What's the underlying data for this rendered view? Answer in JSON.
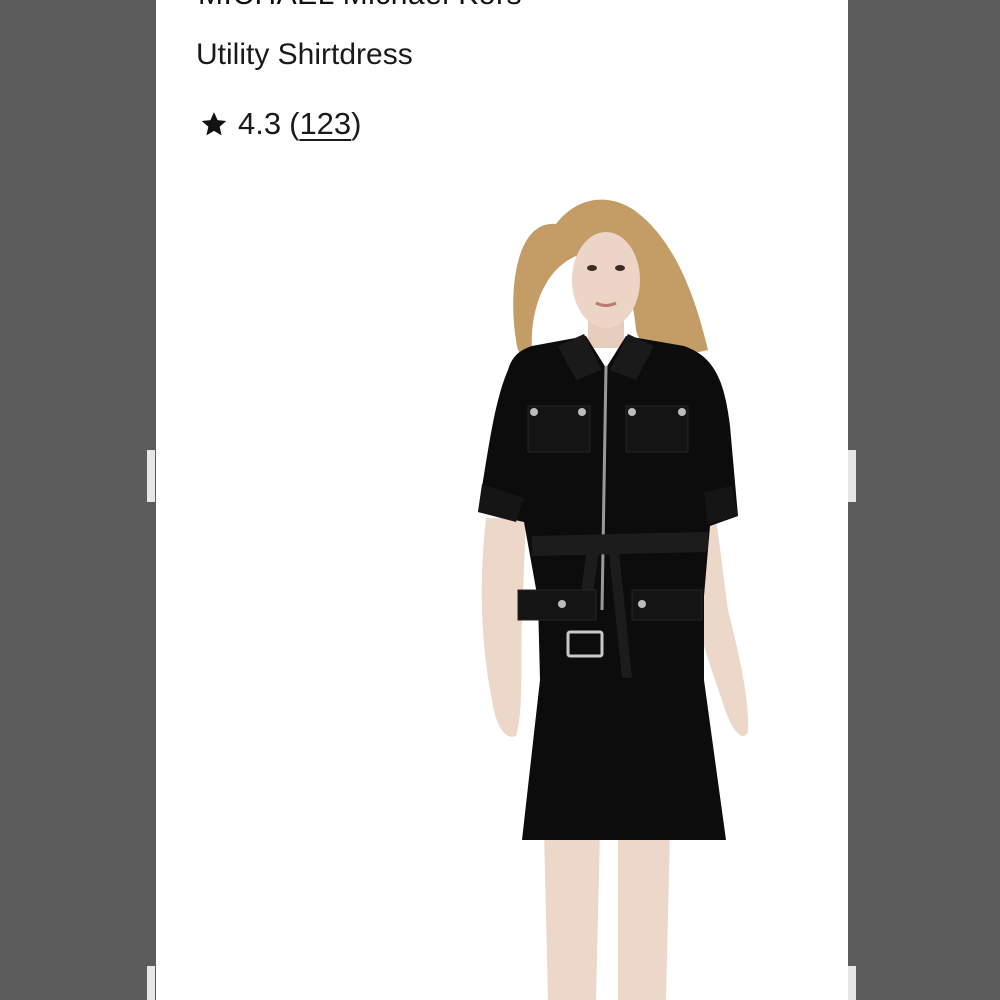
{
  "product": {
    "brand": "MICHAEL Michael Kors",
    "name": "Utility Shirtdress",
    "rating": {
      "score": "4.3",
      "count": "123",
      "open_paren": "(",
      "close_paren": ")",
      "icon": "star-icon"
    },
    "image": {
      "description_icon": "product-photo",
      "dress_color": "#0c0c0c"
    }
  },
  "colors": {
    "backdrop": "#5c5c5c",
    "page": "#ffffff",
    "text": "#1a1a1a"
  }
}
